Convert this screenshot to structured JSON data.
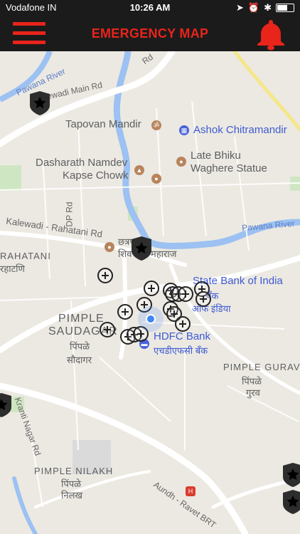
{
  "status_bar": {
    "carrier": "Vodafone IN",
    "time": "10:26 AM"
  },
  "header": {
    "title": "EMERGENCY MAP"
  },
  "colors": {
    "accent": "#e8241b",
    "header_bg": "#1b1b1b",
    "river": "#9cc1f2",
    "map_bg": "#ece9e2"
  },
  "icons": {
    "menu": "hamburger-menu-icon",
    "alert": "bell-icon",
    "station": "police-shield-star-icon",
    "incident": "plus-circle-icon",
    "location": "current-location-dot-icon"
  },
  "map": {
    "labels": {
      "pawana_river_top": "Pawana River",
      "kalewadi_main": "Kalewadi Main Rd",
      "rd_top": "Rd",
      "tapovan": "Tapovan Mandir",
      "ashok": "Ashok Chitramandir",
      "dasharath_1": "Dasharath Namdev",
      "dasharath_2": "Kapse Chowk",
      "late_bhiku_1": "Late Bhiku",
      "late_bhiku_2": "Waghere Statue",
      "dp_rd": "DP Rd",
      "kalewadi_rahatani": "Kalewadi - Rahatani Rd",
      "pawana_river_right": "Pawana River",
      "rahatani": "RAHATANI",
      "rahatani_mr": "रहाटणि",
      "chhatrapati_1": "छत्रप",
      "chhatrapati_2": "शिव",
      "chhatrapati_3": "महाराज",
      "sbi": "State Bank of India",
      "sbi_mr_1": "बँक",
      "sbi_mr_2": "ऑफ इंडिया",
      "pimple_saudagar_1": "PIMPLE",
      "pimple_saudagar_2": "SAUDAGAR",
      "pimple_saudagar_mr_1": "पिंपळे",
      "pimple_saudagar_mr_2": "सौदागर",
      "hdfc": "HDFC Bank",
      "hdfc_mr": "एचडीएफसी बँक",
      "pimple_gurav": "PIMPLE GURAV",
      "pimple_gurav_mr_1": "पिंपळे",
      "pimple_gurav_mr_2": "गुरव",
      "kranti_nagar": "Kranti Nagar Rd",
      "pimple_nilakh": "PIMPLE NILAKH",
      "pimple_nilakh_mr_1": "पिंपळे",
      "pimple_nilakh_mr_2": "निलख",
      "aundh_ravet": "Aundh - Ravet BRT"
    }
  }
}
